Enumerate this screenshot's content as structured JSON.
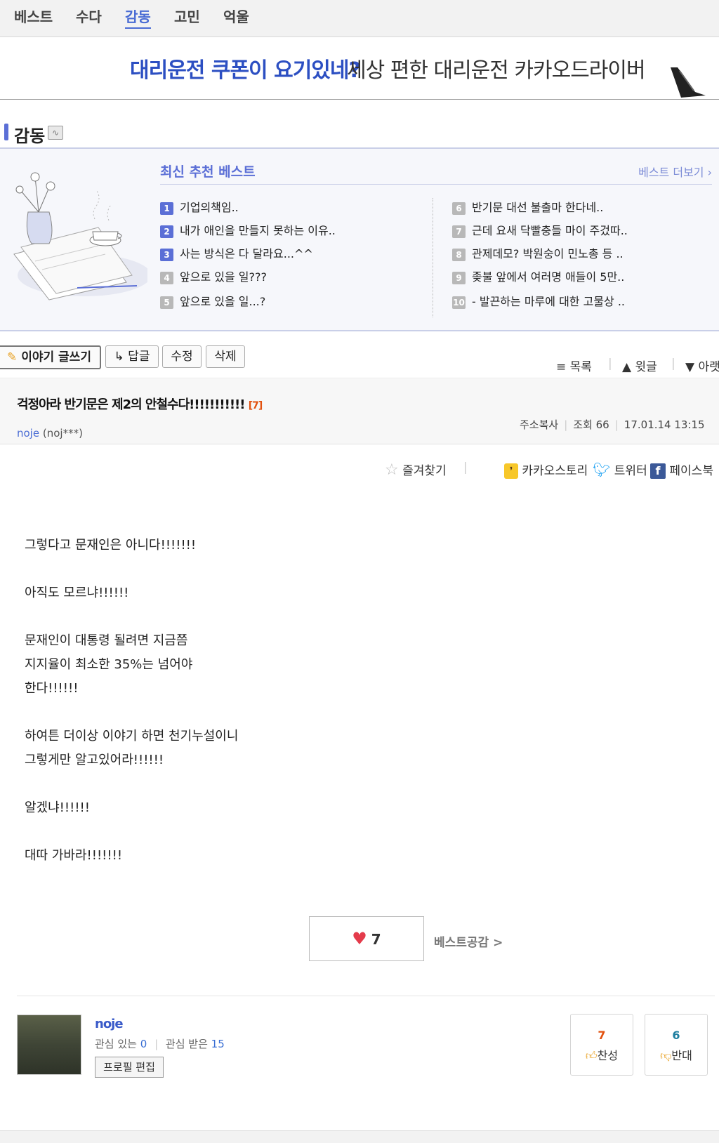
{
  "nav": {
    "tabs": [
      "베스트",
      "수다",
      "감동",
      "고민",
      "억울"
    ],
    "active": "감동"
  },
  "banner": {
    "highlight": "대리운전 쿠폰이 요기있네?",
    "text": "세상 편한 대리운전 카카오드라이버"
  },
  "category": {
    "title": "감동"
  },
  "best": {
    "title": "최신 추천 베스트",
    "more": "베스트 더보기 ›",
    "items": [
      {
        "num": "1",
        "text": "기업의책임.."
      },
      {
        "num": "2",
        "text": "내가 애인을 만들지 못하는 이유.."
      },
      {
        "num": "3",
        "text": "사는 방식은 다 달라요...^^"
      },
      {
        "num": "4",
        "text": "앞으로 있을 일???"
      },
      {
        "num": "5",
        "text": "앞으로 있을 일...?"
      },
      {
        "num": "6",
        "text": "반기문 대선 불출마 한다네.."
      },
      {
        "num": "7",
        "text": "근데 요새 닥빨충들 마이 주겄따.."
      },
      {
        "num": "8",
        "text": "관제데모? 박원숭이 민노총 등 .."
      },
      {
        "num": "9",
        "text": "좆불 앞에서 여러명 애들이 5만.."
      },
      {
        "num": "10",
        "text": "- 발끈하는 마루에 대한 고물상 .."
      }
    ]
  },
  "actions": {
    "write": "이야기 글쓰기",
    "reply": "↳ 답글",
    "edit": "수정",
    "delete": "삭제",
    "list": "≡ 목록",
    "prev": "▲ 윗글",
    "next": "▼ 아랫"
  },
  "post": {
    "title": "걱정아라 반기문은 제2의 안철수다!!!!!!!!!!!",
    "comments": "[7]",
    "author": "noje",
    "author_id": "(noj***)",
    "copy_addr": "주소복사",
    "views": "조회 66",
    "date": "17.01.14 13:15"
  },
  "share": {
    "bookmark": "즐겨찾기",
    "kakao": "카카오스토리",
    "twitter": "트위터",
    "facebook": "페이스북"
  },
  "content": [
    "그렇다고 문재인은 아니다!!!!!!!",
    "아직도 모르냐!!!!!!",
    "문재인이 대통령 될려면 지금쯤\n지지율이 최소한 35%는 넘어야\n한다!!!!!!",
    "하여튼 더이상 이야기 하면 천기누설이니\n그렇게만 알고있어라!!!!!!",
    "알겠냐!!!!!!",
    "대따 가바라!!!!!!!"
  ],
  "like": {
    "count": "7",
    "best_link": "베스트공감 >"
  },
  "profile": {
    "name": "noje",
    "interest_label": "관심 있는",
    "interest": "0",
    "followed_label": "관심 받은",
    "followed": "15",
    "edit": "프로필 편집"
  },
  "votes": {
    "agree_count": "7",
    "agree": "찬성",
    "disagree_count": "6",
    "disagree": "반대"
  },
  "colors": {
    "accent": "#4a6cd4",
    "best_blue": "#5b6fd6",
    "comment_orange": "#e2510f",
    "agree_red": "#e2510f",
    "disagree_teal": "#1f7fa0"
  }
}
